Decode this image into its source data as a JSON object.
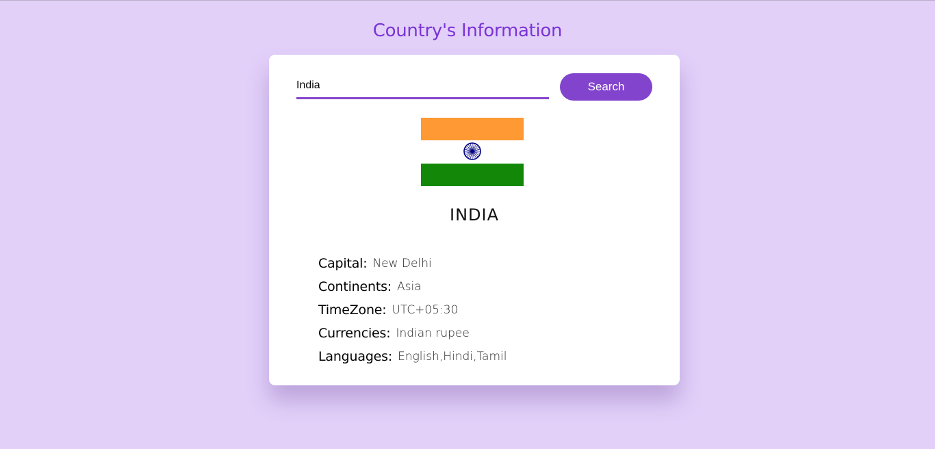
{
  "page": {
    "title": "Country's Information"
  },
  "search": {
    "value": "India",
    "placeholder": "",
    "button_label": "Search"
  },
  "country": {
    "name": "INDIA",
    "flag": {
      "icon": "india-flag-icon",
      "colors": {
        "saffron": "#ff9933",
        "white": "#ffffff",
        "green": "#138808",
        "chakra": "#000080"
      }
    },
    "details": [
      {
        "label": "Capital:",
        "value": "New Delhi"
      },
      {
        "label": "Continents:",
        "value": "Asia"
      },
      {
        "label": "TimeZone:",
        "value": "UTC+05:30"
      },
      {
        "label": "Currencies:",
        "value": "Indian rupee"
      },
      {
        "label": "Languages:",
        "value": "English,Hindi,Tamil"
      }
    ]
  },
  "theme": {
    "background": "#e2d0f9",
    "accent": "#8244cc",
    "title_color": "#7a34d6"
  }
}
